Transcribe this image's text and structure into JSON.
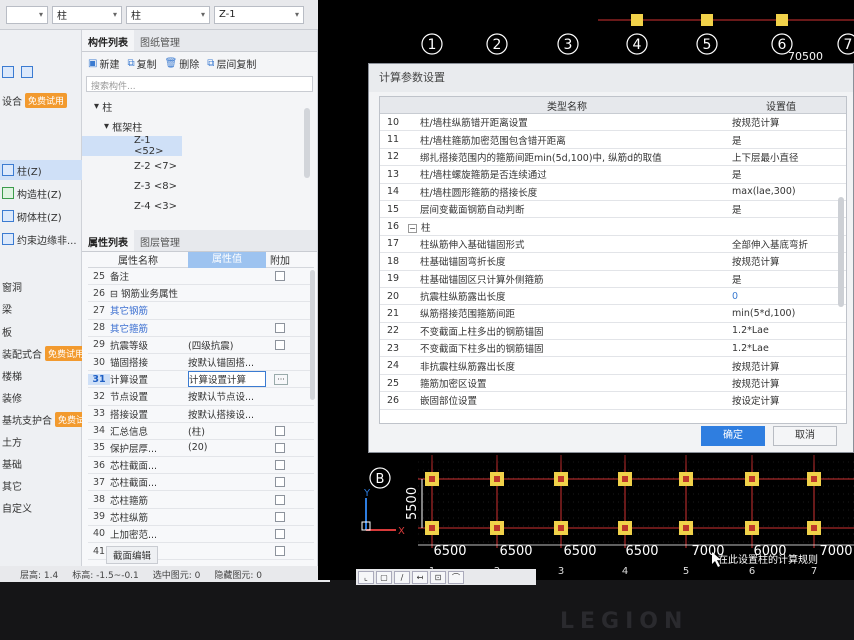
{
  "topbar": {
    "combo1": "",
    "combo2": "柱",
    "combo3": "柱",
    "combo4": "Z-1"
  },
  "left_strip": {
    "items": [
      {
        "label": "设合",
        "badge": "免费试用"
      },
      {
        "label": "柱(Z)"
      },
      {
        "label": "构造柱(Z)"
      },
      {
        "label": "砌体柱(Z)"
      },
      {
        "label": "约束边缘非..."
      },
      {
        "label": "窗洞"
      },
      {
        "label": "梁"
      },
      {
        "label": "板"
      },
      {
        "label": "装配式合",
        "badge": "免费试用"
      },
      {
        "label": "楼梯"
      },
      {
        "label": "装修"
      },
      {
        "label": "基坑支护合",
        "badge": "免费试用"
      },
      {
        "label": "土方"
      },
      {
        "label": "基础"
      },
      {
        "label": "其它"
      },
      {
        "label": "自定义"
      }
    ]
  },
  "component_panel": {
    "tabs": [
      "构件列表",
      "图纸管理"
    ],
    "toolbar": {
      "new": "新建",
      "copy": "复制",
      "delete": "删除",
      "layer_copy": "层间复制"
    },
    "search_placeholder": "搜索构件...",
    "tree": {
      "root": "柱",
      "group": "框架柱",
      "items": [
        "Z-1 <52>",
        "Z-2 <7>",
        "Z-3 <8>",
        "Z-4 <3>"
      ]
    }
  },
  "property_panel": {
    "tabs": [
      "属性列表",
      "图层管理"
    ],
    "headers": {
      "name": "属性名称",
      "value": "属性值",
      "add": "附加"
    },
    "rows": [
      {
        "num": "25",
        "name": "备注",
        "value": "",
        "cb": true
      },
      {
        "num": "26",
        "name": "⊟ 钢筋业务属性",
        "value": "",
        "cb": false
      },
      {
        "num": "27",
        "name": "其它钢筋",
        "value": "",
        "cb": false,
        "blue": true
      },
      {
        "num": "28",
        "name": "其它箍筋",
        "value": "",
        "cb": true,
        "blue": true
      },
      {
        "num": "29",
        "name": "抗震等级",
        "value": "(四级抗震)",
        "cb": true
      },
      {
        "num": "30",
        "name": "锚固搭接",
        "value": "按默认锚固搭...",
        "cb": false
      },
      {
        "num": "31",
        "name": "计算设置",
        "value": "计算设置计算",
        "cb": false,
        "hl": true
      },
      {
        "num": "32",
        "name": "节点设置",
        "value": "按默认节点设...",
        "cb": false
      },
      {
        "num": "33",
        "name": "搭接设置",
        "value": "按默认搭接设...",
        "cb": false
      },
      {
        "num": "34",
        "name": "汇总信息",
        "value": "(柱)",
        "cb": true
      },
      {
        "num": "35",
        "name": "保护层厚...",
        "value": "(20)",
        "cb": true
      },
      {
        "num": "36",
        "name": "芯柱截面...",
        "value": "",
        "cb": true
      },
      {
        "num": "37",
        "name": "芯柱截面...",
        "value": "",
        "cb": true
      },
      {
        "num": "38",
        "name": "芯柱箍筋",
        "value": "",
        "cb": true
      },
      {
        "num": "39",
        "name": "芯柱纵筋",
        "value": "",
        "cb": true
      },
      {
        "num": "40",
        "name": "上加密范...",
        "value": "",
        "cb": true
      },
      {
        "num": "41",
        "name": "下加密范...",
        "value": "",
        "cb": true
      }
    ],
    "footer": "截面编辑"
  },
  "statusbar": {
    "floor": "层高: 1.4",
    "elev": "标高: -1.5~-0.1",
    "selected": "选中图元: 0",
    "hidden": "隐藏图元: 0"
  },
  "dialog": {
    "title": "计算参数设置",
    "headers": {
      "name": "类型名称",
      "value": "设置值"
    },
    "rows": [
      {
        "num": "10",
        "name": "柱/墙柱纵筋错开距离设置",
        "value": "按规范计算"
      },
      {
        "num": "11",
        "name": "柱/墙柱箍筋加密范围包含错开距离",
        "value": "是"
      },
      {
        "num": "12",
        "name": "绑扎搭接范围内的箍筋间距min(5d,100)中, 纵筋d的取值",
        "value": "上下层最小直径"
      },
      {
        "num": "13",
        "name": "柱/墙柱螺旋箍筋是否连续通过",
        "value": "是"
      },
      {
        "num": "14",
        "name": "柱/墙柱圆形箍筋的搭接长度",
        "value": "max(lae,300)"
      },
      {
        "num": "15",
        "name": "层间变截面钢筋自动判断",
        "value": "是"
      },
      {
        "num": "16",
        "name": "柱",
        "value": "",
        "group": true
      },
      {
        "num": "17",
        "name": "柱纵筋伸入基础锚固形式",
        "value": "全部伸入基底弯折"
      },
      {
        "num": "18",
        "name": "柱基础锚固弯折长度",
        "value": "按规范计算"
      },
      {
        "num": "19",
        "name": "柱基础锚固区只计算外侧箍筋",
        "value": "是"
      },
      {
        "num": "20",
        "name": "抗震柱纵筋露出长度",
        "value": "0",
        "blue": true
      },
      {
        "num": "21",
        "name": "纵筋搭接范围箍筋间距",
        "value": "min(5*d,100)"
      },
      {
        "num": "22",
        "name": "不变截面上柱多出的钢筋锚固",
        "value": "1.2*Lae"
      },
      {
        "num": "23",
        "name": "不变截面下柱多出的钢筋锚固",
        "value": "1.2*Lae"
      },
      {
        "num": "24",
        "name": "非抗震柱纵筋露出长度",
        "value": "按规范计算"
      },
      {
        "num": "25",
        "name": "箍筋加密区设置",
        "value": "按规范计算"
      },
      {
        "num": "26",
        "name": "嵌固部位设置",
        "value": "按设定计算"
      }
    ],
    "ok": "确定",
    "cancel": "取消"
  },
  "canvas": {
    "top_axes": [
      "1",
      "2",
      "3",
      "4",
      "5",
      "6",
      "7"
    ],
    "top_dim": "70500",
    "axis_b": "B",
    "dim_vert": "5500",
    "bottom_dims": [
      "6500",
      "6500",
      "6500",
      "6500",
      "7000",
      "6000",
      "7000"
    ],
    "bottom_axes": [
      "1",
      "2",
      "3",
      "4",
      "5",
      "6",
      "7"
    ],
    "hint": "在此设置柱的计算规则",
    "colors": {
      "grid": "#d23232",
      "column": "#f1d24a",
      "axis_bubble": "#ffffff"
    }
  }
}
